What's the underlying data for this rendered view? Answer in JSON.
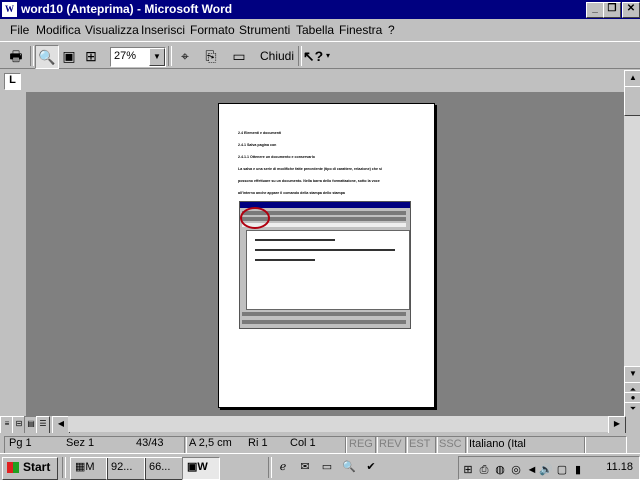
{
  "window": {
    "title": "word10 (Anteprima) - Microsoft Word",
    "app_icon": "word-doc-icon"
  },
  "caption_buttons": {
    "minimize": "_",
    "restore": "❐",
    "close": "✕"
  },
  "menu": [
    "File",
    "Modifica",
    "Visualizza",
    "Inserisci",
    "Formato",
    "Strumenti",
    "Tabella",
    "Finestra",
    "?"
  ],
  "toolbar": {
    "zoom_value": "27%",
    "close_label": "Chiudi"
  },
  "document": {
    "heading1": "2.4 Elementi e documenti",
    "heading2": "2.4.1 Salva pagina con",
    "heading3": "2.4.1.1 Ottenere un documento e conservarlo",
    "body1": "La salva e una serie di modifiche fatte precedente (tipo di carattere, relazione) che si",
    "body2": "possono effettuare su un documento. Nella barra dello formattazione, sotto la voce",
    "body3": "all'interno anche appare il comando della stampa dello stampa"
  },
  "status": {
    "page": "Pg  1",
    "section": "Sez  1",
    "pages": "43/43",
    "at": "A  2,5 cm",
    "line": "Ri  1",
    "column": "Col  1",
    "reg": "REG",
    "rev": "REV",
    "est": "EST",
    "ssc": "SSC",
    "language": "Italiano (Ital"
  },
  "taskbar": {
    "start": "Start",
    "tasks": [
      "M",
      "92...",
      "66...",
      "W"
    ],
    "clock": "11.18"
  },
  "colors": {
    "titlebar": "#000080",
    "workspace": "#808080",
    "chrome": "#c0c0c0",
    "highlight_circle": "#b00010"
  }
}
